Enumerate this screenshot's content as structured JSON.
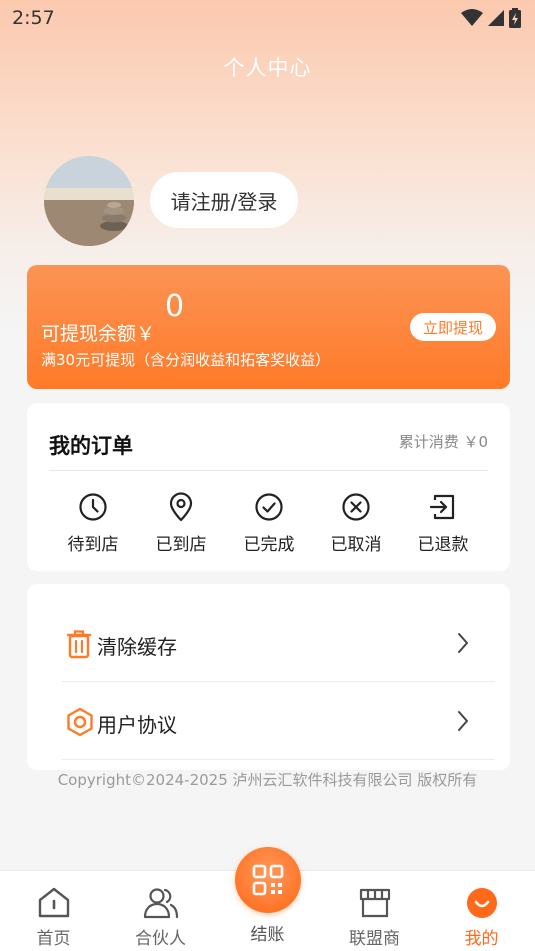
{
  "status_bar": {
    "time": "2:57"
  },
  "header": {
    "title": "个人中心"
  },
  "profile": {
    "login_prompt": "请注册/登录"
  },
  "balance": {
    "label": "可提现余额￥",
    "value": "0",
    "note": "满30元可提现（含分润收益和拓客奖收益）",
    "withdraw_button": "立即提现"
  },
  "orders": {
    "title": "我的订单",
    "total_spent": "累计消费 ￥0",
    "items": [
      {
        "label": "待到店",
        "icon": "clock-icon"
      },
      {
        "label": "已到店",
        "icon": "location-pin-icon"
      },
      {
        "label": "已完成",
        "icon": "check-circle-icon"
      },
      {
        "label": "已取消",
        "icon": "x-circle-icon"
      },
      {
        "label": "已退款",
        "icon": "refund-arrow-icon"
      }
    ]
  },
  "menu": {
    "items": [
      {
        "label": "清除缓存",
        "icon": "trash-icon"
      },
      {
        "label": "用户协议",
        "icon": "hexagon-icon"
      }
    ]
  },
  "footer": {
    "copyright": "Copyright©2024-2025 泸州云汇软件科技有限公司 版权所有"
  },
  "tabbar": {
    "items": [
      {
        "label": "首页",
        "icon": "home-icon",
        "active": false
      },
      {
        "label": "合伙人",
        "icon": "partners-icon",
        "active": false
      },
      {
        "label": "结账",
        "icon": "qr-code-icon",
        "active": false
      },
      {
        "label": "联盟商",
        "icon": "store-icon",
        "active": false
      },
      {
        "label": "我的",
        "icon": "smile-icon",
        "active": true
      }
    ]
  },
  "colors": {
    "accent": "#ff7a28",
    "active_tab": "#ff6a1a"
  }
}
